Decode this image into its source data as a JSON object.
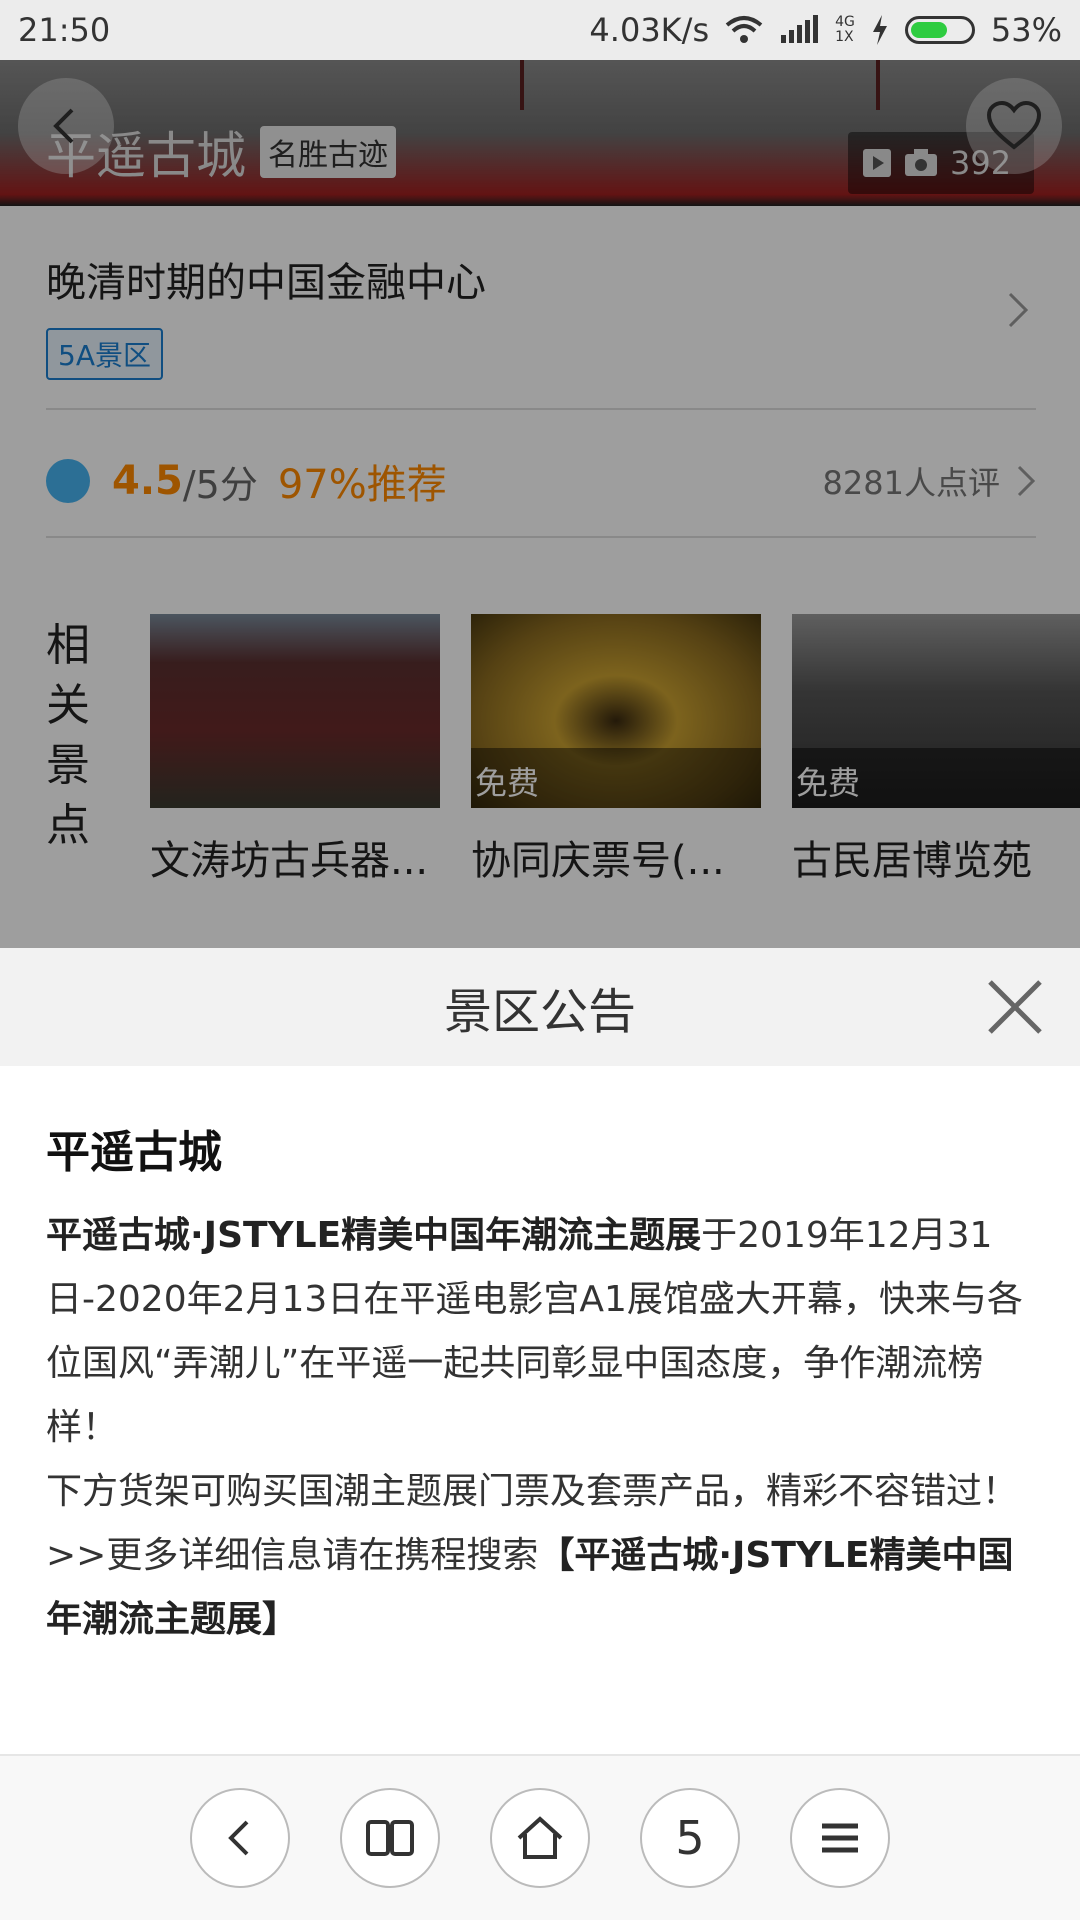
{
  "status_bar": {
    "time": "21:50",
    "speed": "4.03K/s",
    "network_top": "4G",
    "network_bottom": "1X",
    "battery": "53%"
  },
  "header": {
    "title": "平遥古城",
    "category_tag": "名胜古迹",
    "photo_count": "392"
  },
  "summary": {
    "subtitle": "晚清时期的中国金融中心",
    "level_tag": "5A景区"
  },
  "rating": {
    "score": "4.5",
    "score_max": "/5分",
    "recommend": "97%推荐",
    "reviews": "8281人点评"
  },
  "related": {
    "label": "相关景点",
    "items": [
      {
        "name": "文涛坊古兵器...",
        "badge": ""
      },
      {
        "name": "协同庆票号(...",
        "badge": "免费"
      },
      {
        "name": "古民居博览苑",
        "badge": "免费"
      }
    ]
  },
  "notice": {
    "title": "景区公告",
    "heading": "平遥古城",
    "para1_bold": "平遥古城·JSTYLE精美中国年潮流主题展",
    "para1_rest": "于2019年12月31日-2020年2月13日在平遥电影宫A1展馆盛大开幕，快来与各位国风“弄潮儿”在平遥一起共同彰显中国态度，争作潮流榜样！",
    "para2": "下方货架可购买国潮主题展门票及套票产品，精彩不容错过！",
    "para3_prefix": ">>更多详细信息请在携程搜索",
    "para3_bold": "【平遥古城·JSTYLE精美中国年潮流主题展】"
  },
  "bottom_nav": {
    "tabs_count": "5"
  }
}
